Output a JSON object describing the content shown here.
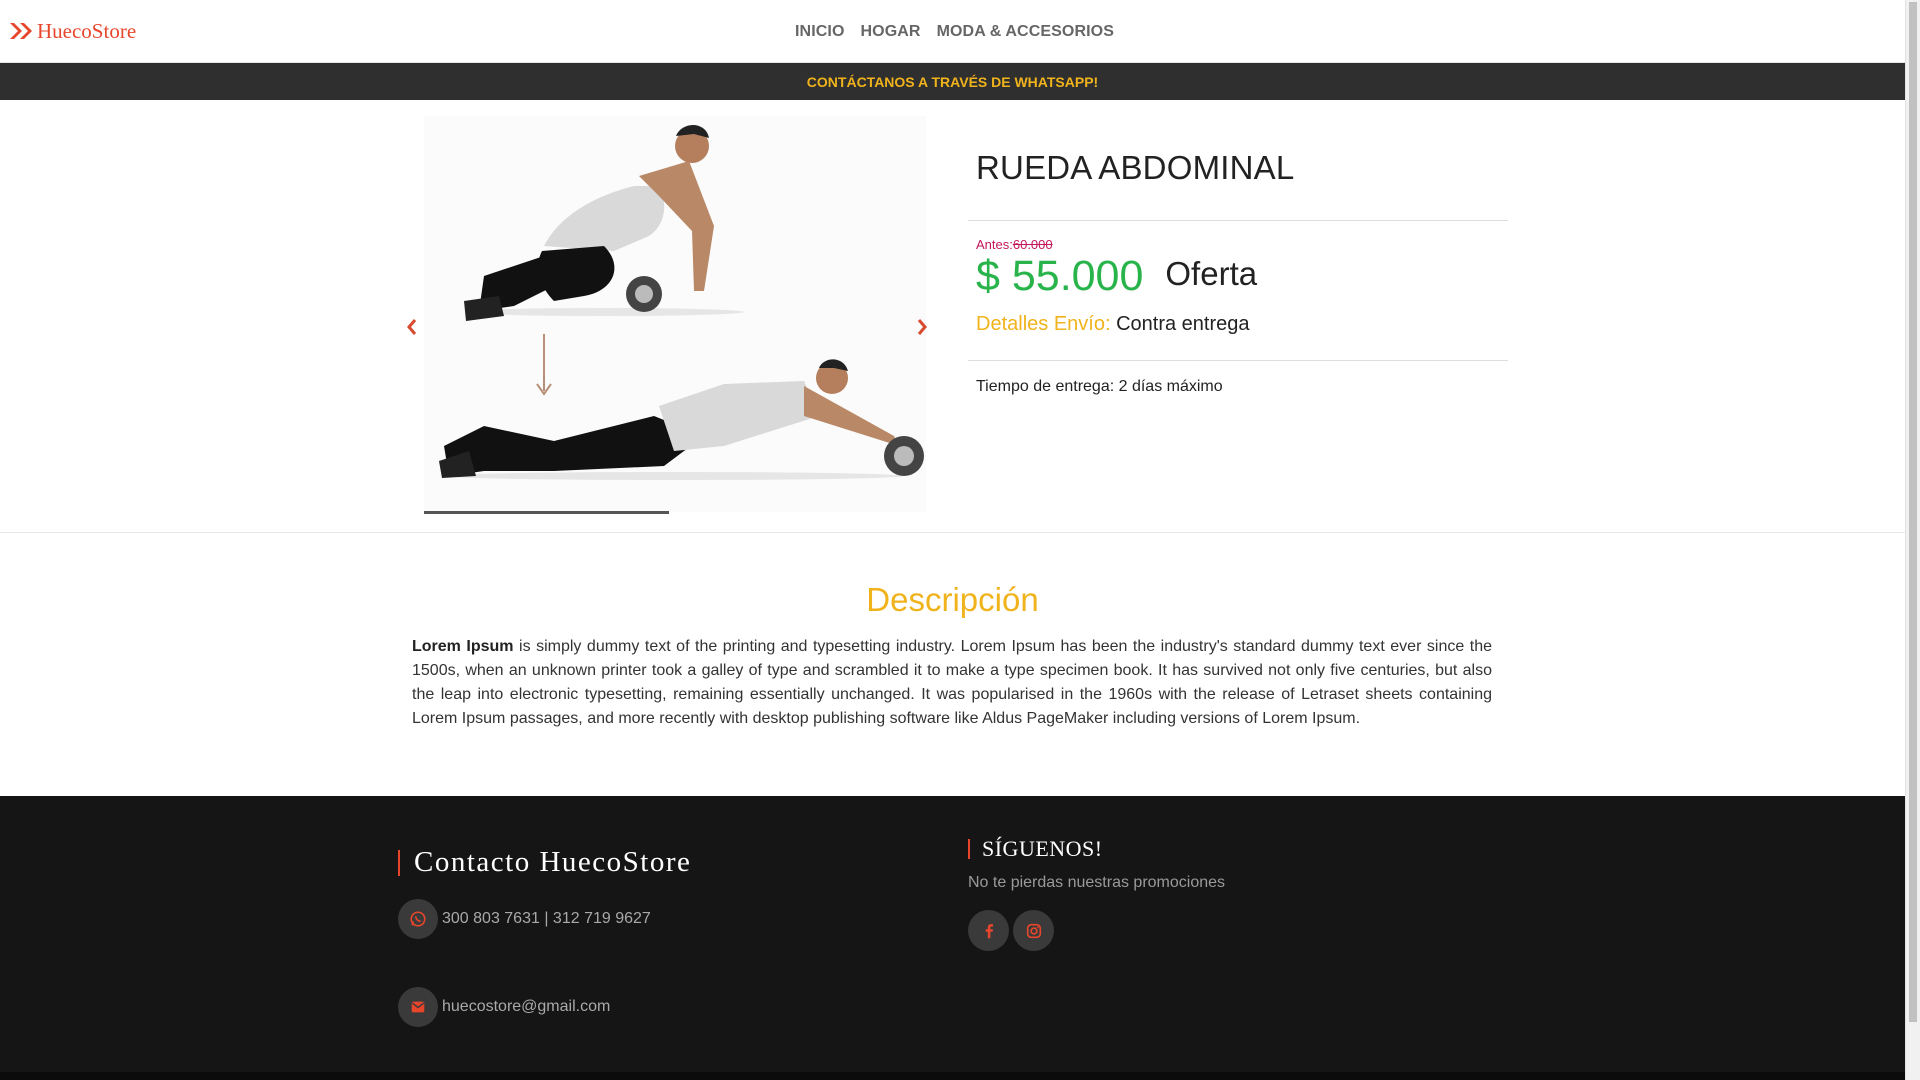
{
  "header": {
    "brand": "HuecoStore",
    "nav": [
      "INICIO",
      "HOGAR",
      "MODA & ACCESORIOS"
    ]
  },
  "promo_bar": "CONTÁCTANOS A TRAVÉS DE WHATSAPP!",
  "product": {
    "title": "RUEDA ABDOMINAL",
    "before_label": "Antes:",
    "before_price": "60.000",
    "price": "$ 55.000",
    "offer_label": "Oferta",
    "shipping_label": "Detalles Envío:",
    "shipping_value": "Contra entrega",
    "delivery_time": "Tiempo de entrega: 2 días máximo",
    "carousel_prev_icon": "chevron-left-icon",
    "carousel_next_icon": "chevron-right-icon"
  },
  "description": {
    "heading": "Descripción",
    "lead": "Lorem Ipsum",
    "body": " is simply dummy text of the printing and typesetting industry. Lorem Ipsum has been the industry's standard dummy text ever since the 1500s, when an unknown printer took a galley of type and scrambled it to make a type specimen book. It has survived not only five centuries, but also the leap into electronic typesetting, remaining essentially unchanged. It was popularised in the 1960s with the release of Letraset sheets containing Lorem Ipsum passages, and more recently with desktop publishing software like Aldus PageMaker including versions of Lorem Ipsum."
  },
  "footer": {
    "contact_title": "Contacto HuecoStore",
    "phones": "300 803 7631 | 312 719 9627",
    "email": "huecostore@gmail.com",
    "follow_title": "SÍGUENOS!",
    "follow_subtitle": "No te pierdas nuestras promociones",
    "icons": [
      "whatsapp-icon",
      "envelope-icon",
      "facebook-icon",
      "instagram-icon"
    ]
  },
  "colors": {
    "brand": "#e8462c",
    "accent_yellow": "#f0b31c",
    "price_green": "#28b44b",
    "before_price": "#c2185b",
    "footer_bg": "#151515"
  }
}
